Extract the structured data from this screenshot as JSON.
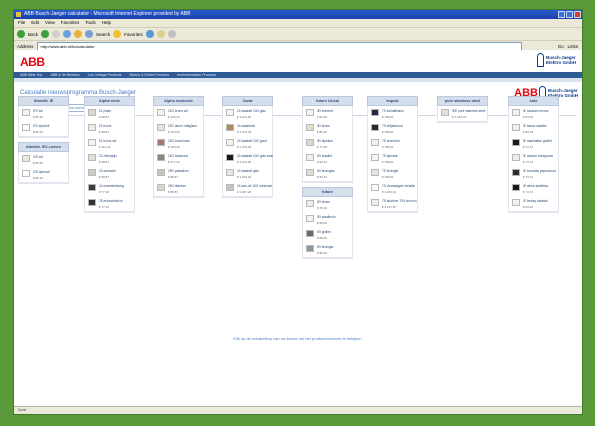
{
  "window": {
    "title": "ABB Busch-Jaeger calculator - Microsoft Internet Explorer provided by ABB"
  },
  "menu": [
    "File",
    "Edit",
    "View",
    "Favorites",
    "Tools",
    "Help"
  ],
  "toolbar": {
    "back": "Back",
    "search": "Search",
    "favorites": "Favorites"
  },
  "address": {
    "label": "Address",
    "url": "http://www.abb.nl/bc/calculator",
    "go": "Go",
    "links": "Links"
  },
  "brand": {
    "abb": "ABB",
    "bj_line1": "Busch-Jaeger",
    "bj_line2": "Elektro GmbH"
  },
  "nav": [
    "ABB Near You",
    "ABB in de Benelux",
    "Low Voltage Products",
    "Motors & Drives Products",
    "Instrumentation Products"
  ],
  "page": {
    "title": "Calculatie nieuwsprogramma Busch-Jaeger"
  },
  "tabs": [
    "Assortiment",
    "Programma overzicht",
    "Help"
  ],
  "columns": [
    {
      "header": "Afwerkt. IE",
      "items": [
        {
          "name": "IFZ wit",
          "price": "€ 85,10",
          "color": "#f4f2ec"
        },
        {
          "name": "IFZ alpinwit",
          "price": "€ 85,10",
          "color": "#ffffff"
        }
      ],
      "sub_header": "Afwerkt. IE2 Lumen",
      "sub_items": [
        {
          "name": "IZS wit",
          "price": "€ 85,10",
          "color": "#efe8d8"
        },
        {
          "name": "IZS alpinwit",
          "price": "€ 85,10",
          "color": "#ffffff"
        }
      ]
    },
    {
      "header": "Alpha rente",
      "items": [
        {
          "name": "21 platin",
          "price": "€ 98,87",
          "color": "#d8d6d0"
        },
        {
          "name": "21 brons",
          "price": "€ 98,87",
          "color": "#f0ece0"
        },
        {
          "name": "21 brons wit",
          "price": "€ 113,24",
          "color": "#f6f4ee"
        },
        {
          "name": "22 zilvergrijs",
          "price": "€ 98,87",
          "color": "#e0ded8"
        },
        {
          "name": "23 antraciet",
          "price": "€ 98,87",
          "color": "#d0cdc6"
        },
        {
          "name": "24 marmerkleurig",
          "price": "€ 77,10",
          "color": "#3a3a3a"
        },
        {
          "name": "25 antracietbruin",
          "price": "€ 77,10",
          "color": "#303030"
        }
      ]
    },
    {
      "header": "Alpha exclusive",
      "items": [
        {
          "name": "21G brons wit",
          "price": "€ 126,24",
          "color": "#f4f2ec"
        },
        {
          "name": "22G alumi. stalglans",
          "price": "€ 104,20",
          "color": "#e6e4de"
        },
        {
          "name": "23G brons/rose",
          "price": "€ 104,20",
          "color": "#a07870"
        },
        {
          "name": "24G staalrood",
          "price": "€ 177,40",
          "color": "#8a8680"
        },
        {
          "name": "25G palladium",
          "price": "€ 88,87",
          "color": "#c8c4bc"
        },
        {
          "name": "28G titanium",
          "price": "€ 88,87",
          "color": "#d8d6d0"
        }
      ]
    },
    {
      "header": "Carat",
      "items": [
        {
          "name": "24 staalwit 10G glas",
          "price": "€ 1.101,00",
          "color": "#f6f4f0"
        },
        {
          "name": "24 staalbruin",
          "price": "€ 1.374,23",
          "color": "#b08a5a"
        },
        {
          "name": "24 staalwit 10G goud",
          "price": "€ 1.374,23",
          "color": "#f6f2e6"
        },
        {
          "name": "24 staalwit 10G glas zwart",
          "price": "€ 1.101,00",
          "color": "#1a1a1a"
        },
        {
          "name": "24 staalwit glas",
          "price": "€ 1.044,22",
          "color": "#e8e6e2"
        },
        {
          "name": "24 aan-uit 10G roestvast",
          "price": "€ 1.097,20",
          "color": "#c8c6c0"
        }
      ]
    },
    {
      "header": "future Lineal",
      "items": [
        {
          "name": "IEI zilverbrt",
          "price": "€ 84,00",
          "color": "#f4f2ee"
        },
        {
          "name": "IEI brons",
          "price": "€ 85,26",
          "color": "#e8dfca"
        },
        {
          "name": "IEI alpinbru",
          "price": "€ 77,56",
          "color": "#ddd8cc"
        },
        {
          "name": "IEI staalbrt",
          "price": "€ 84,24",
          "color": "#f2f0ec"
        },
        {
          "name": "IEI bruinglas",
          "price": "€ 84,24",
          "color": "#e0dcd4"
        }
      ],
      "sub_header": "future",
      "sub_items": [
        {
          "name": "IEI brons",
          "price": "€ 79,16",
          "color": "#f0ede6"
        },
        {
          "name": "IEI staalbruin",
          "price": "€ 86,00",
          "color": "#f4f2ee"
        },
        {
          "name": "IEI grafiet",
          "price": "€ 86,00",
          "color": "#6a6a6a"
        },
        {
          "name": "IEI bruingla",
          "price": "€ 86,00",
          "color": "#8a9aa0"
        }
      ]
    },
    {
      "header": "Impuls",
      "items": [
        {
          "name": "7S kobaltblauw",
          "price": "€ 786,01",
          "color": "#202a40"
        },
        {
          "name": "7S briljantrood",
          "price": "€ 786,01",
          "color": "#2a2a2a"
        },
        {
          "name": "7S brons/wit",
          "price": "€ 786,01",
          "color": "#f2f0ea"
        },
        {
          "name": "7S alpinwit",
          "price": "€ 786,01",
          "color": "#f6f6f6"
        },
        {
          "name": "7S bruingla",
          "price": "€ 786,01",
          "color": "#e6e4de"
        },
        {
          "name": "7S champagne metallic",
          "price": "€ 1.281,11",
          "color": "#ffffff"
        },
        {
          "name": "7S aluzilver 7S4 chroom",
          "price": "€ 1.127,87",
          "color": "#eeeeee"
        }
      ]
    },
    {
      "header": "pure stainless steel",
      "items": [
        {
          "name": "IEE pure stainless steel",
          "price": "€ 1.192,31",
          "color": "#e0e0de"
        }
      ]
    },
    {
      "header": "solo",
      "items": [
        {
          "name": "IE cassiano brons",
          "price": "€ 63,00",
          "color": "#f4f2ee"
        },
        {
          "name": "IE blauw staalbrt",
          "price": "€ 83,16",
          "color": "#f2f0ec"
        },
        {
          "name": "IE manhattan grafiet",
          "price": "€ 74,74",
          "color": "#1a1a1a"
        },
        {
          "name": "IE cassou bordgrauw",
          "price": "€ 74,74",
          "color": "#f0eee8"
        },
        {
          "name": "IE bocadas peperwood",
          "price": "€ 74,74",
          "color": "#2e2e30"
        },
        {
          "name": "IE africa stahlblau",
          "price": "€ 74,74",
          "color": "#1a1a1a"
        },
        {
          "name": "IE besley staalwit",
          "price": "€ 63,00",
          "color": "#f4f2ee"
        }
      ]
    }
  ],
  "hint": "Klik op de schakelkop van uw keuze om het productoverzicht te bekijken.",
  "status": "Done"
}
